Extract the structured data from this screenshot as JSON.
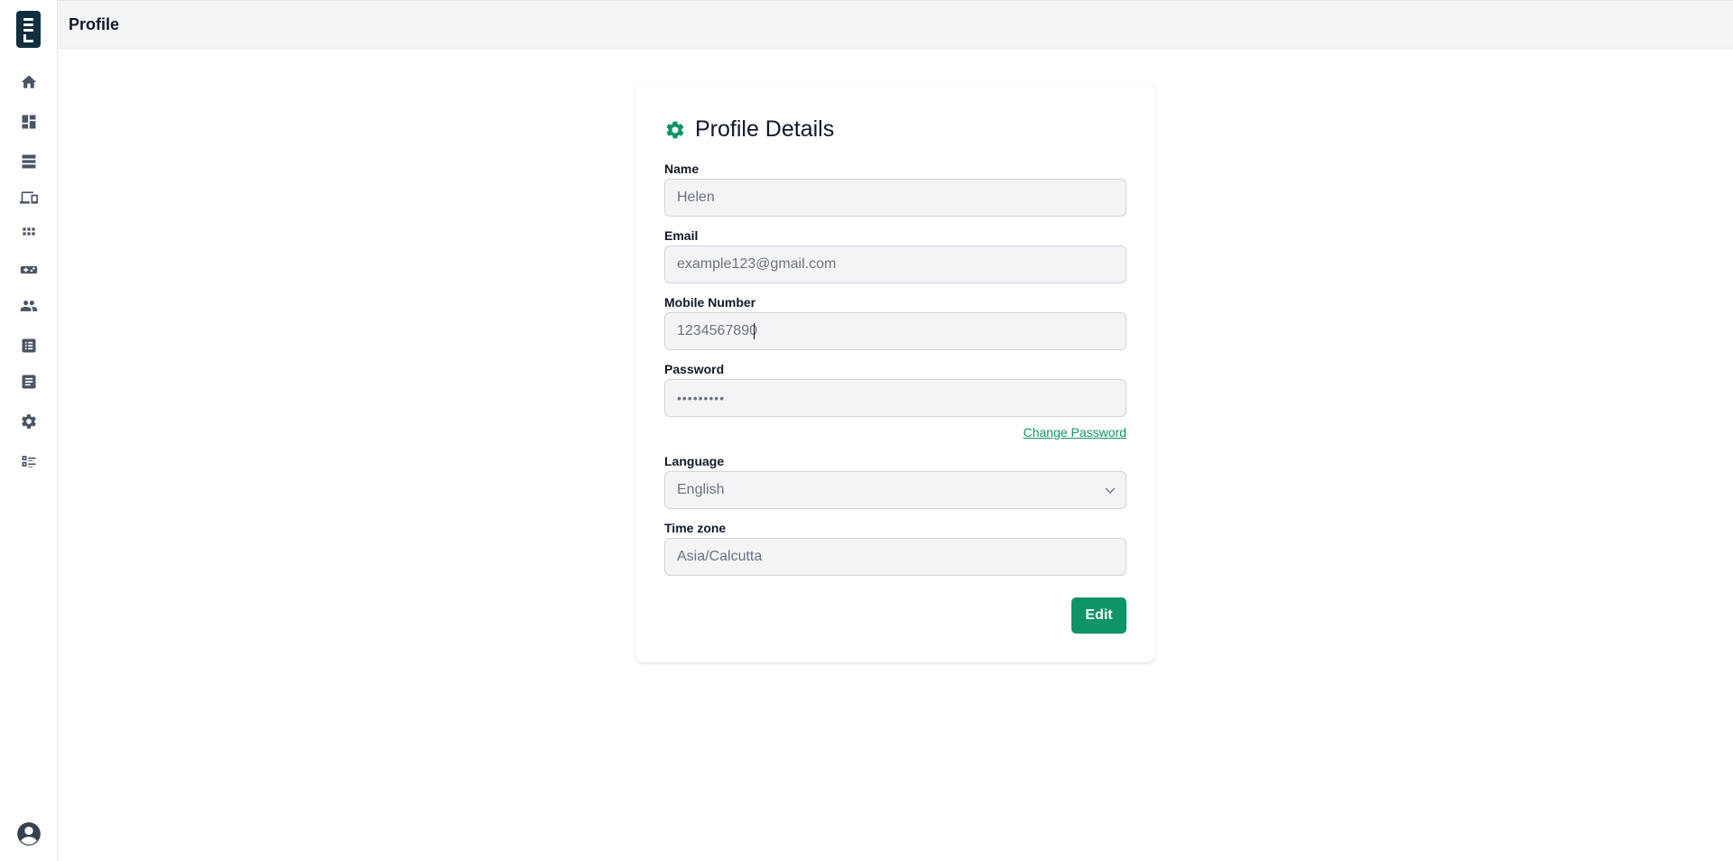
{
  "header": {
    "title": "Profile"
  },
  "sidebar": {
    "items": [
      {
        "icon": "home-icon"
      },
      {
        "icon": "dashboard-icon"
      },
      {
        "icon": "storage-icon"
      },
      {
        "icon": "devices-icon"
      },
      {
        "icon": "apps-grid-icon"
      },
      {
        "icon": "gamepad-icon"
      },
      {
        "icon": "users-icon"
      },
      {
        "icon": "list-icon"
      },
      {
        "icon": "document-icon"
      },
      {
        "icon": "settings-icon"
      },
      {
        "icon": "checklist-icon"
      }
    ],
    "profile_icon": "account-circle-icon"
  },
  "profile": {
    "title": "Profile Details",
    "name_label": "Name",
    "name_value": "Helen",
    "email_label": "Email",
    "email_value": "example123@gmail.com",
    "mobile_label": "Mobile Number",
    "mobile_value": "1234567890",
    "password_label": "Password",
    "password_value": "•••••••••",
    "change_password": "Change Password",
    "language_label": "Language",
    "language_value": "English",
    "timezone_label": "Time zone",
    "timezone_value": "Asia/Calcutta",
    "edit_button": "Edit"
  },
  "colors": {
    "accent": "#0e9467",
    "logo": "#10303f",
    "field_bg": "#f3f4f6"
  }
}
